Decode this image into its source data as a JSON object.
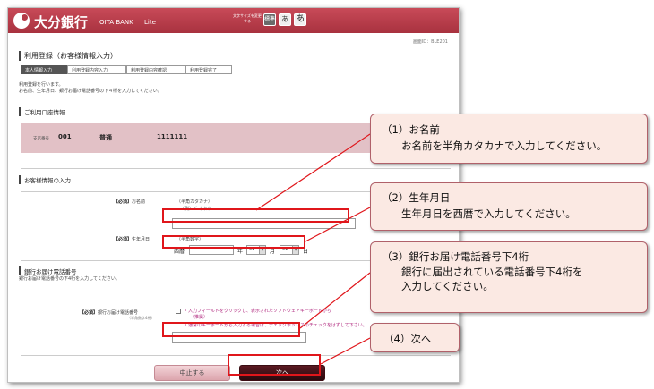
{
  "header": {
    "bank_name": "大分銀行",
    "bank_name_en": "OITA BANK",
    "lite_label": "Lite",
    "text_size_label": "文字サイズを変更する",
    "size_buttons": [
      "標準",
      "あ",
      "あ"
    ]
  },
  "screen_id": "画面ID：BLE201",
  "page_title": "利用登録（お客様情報入力）",
  "steps": [
    "本人情報入力",
    "利用登録内容入力",
    "利用登録内容確認",
    "利用登録完了"
  ],
  "intro": {
    "line1": "利用登録を行います。",
    "line2": "お名前、生年月日、銀行お届け電話番号の下４桁を入力してください。"
  },
  "account_section": {
    "heading": "ご利用口座情報",
    "branch_label": "支店番号",
    "branch_number": "001",
    "account_type": "普通",
    "account_number": "1111111"
  },
  "customer_section": {
    "heading": "お客様情報の入力",
    "required_tag": "【必須】",
    "name_label": "お名前",
    "name_hint": "（半角カタカナ）",
    "name_example": "（例）ﾃﾞｰﾀ ﾀﾛｳ",
    "name_value": "",
    "birth_label": "生年月日",
    "birth_hint": "（半角数字）",
    "era": "西暦",
    "year_value": "",
    "year_unit": "年",
    "month_value": "01",
    "month_unit": "月",
    "day_value": "01",
    "day_unit": "日"
  },
  "phone_section": {
    "heading": "銀行お届け電話番号",
    "description": "銀行お届け電話番号の下4桁を入力してください。",
    "required_tag": "【必須】",
    "label": "銀行お届け電話番号",
    "sub_label": "（半角数字4桁）",
    "keyboard_note1": "・入力フィールドをクリックし、表示されたソフトウェアキーボードから",
    "keyboard_note2": "（推奨）",
    "keyboard_note3": "・通常のキーボードから入力する場合は、チェックボックスのチェックをはずして下さい。",
    "value": ""
  },
  "buttons": {
    "cancel": "中止する",
    "next": "次へ"
  },
  "callouts": [
    {
      "title": "（1）お名前",
      "body": [
        "お名前を半角カタカナで入力してください。"
      ]
    },
    {
      "title": "（2）生年月日",
      "body": [
        "生年月日を西暦で入力してください。"
      ]
    },
    {
      "title": "（3）銀行お届け電話番号下4桁",
      "body": [
        "銀行に届出されている電話番号下4桁を",
        "入力してください。"
      ]
    },
    {
      "title": "（4）次へ",
      "body": []
    }
  ],
  "colors": {
    "brand": "#b53a47",
    "highlight": "#e0161b",
    "callout_bg": "#fbe9e3",
    "account_band": "#e2c1c6"
  }
}
